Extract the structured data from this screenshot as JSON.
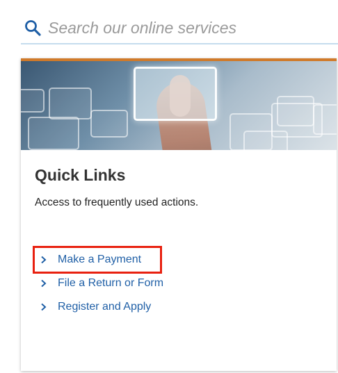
{
  "search": {
    "placeholder": "Search our online services",
    "icon": "search-icon"
  },
  "colors": {
    "accent": "#d07a2a",
    "link": "#1f5fa6",
    "highlight": "#e8200f",
    "search_underline": "#c5dcee"
  },
  "quick_links": {
    "title": "Quick Links",
    "description": "Access to frequently used actions.",
    "items": [
      {
        "label": "Make a Payment",
        "icon": "chevron-right-icon",
        "highlighted": true
      },
      {
        "label": "File a Return or Form",
        "icon": "chevron-right-icon",
        "highlighted": false
      },
      {
        "label": "Register and Apply",
        "icon": "chevron-right-icon",
        "highlighted": false
      }
    ]
  }
}
